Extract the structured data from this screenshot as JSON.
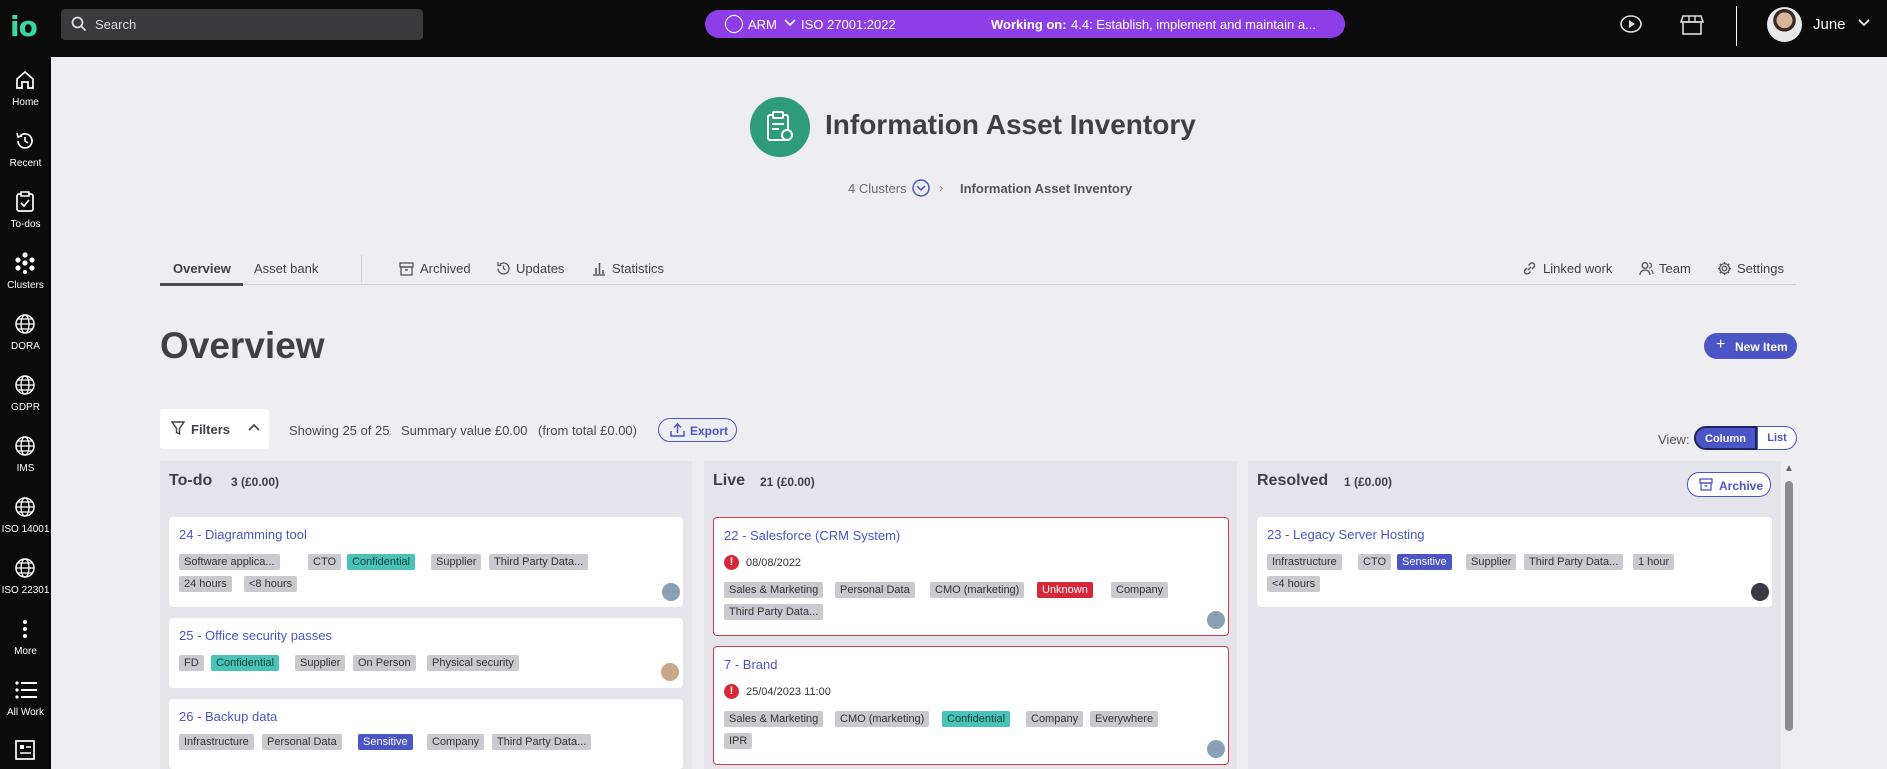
{
  "topbar": {
    "search_placeholder": "Search",
    "org": "ARM",
    "standard": "ISO 27001:2022",
    "working_on_label": "Working on:",
    "working_on_task": "4.4: Establish, implement and maintain a...",
    "user_name": "June",
    "accent": "#8e3ee6"
  },
  "sidebar": {
    "items": [
      {
        "label": "Home",
        "icon": "home-icon"
      },
      {
        "label": "Recent",
        "icon": "history-icon"
      },
      {
        "label": "To-dos",
        "icon": "clipboard-check-icon"
      },
      {
        "label": "Clusters",
        "icon": "clusters-icon"
      },
      {
        "label": "DORA",
        "icon": "globe-icon"
      },
      {
        "label": "GDPR",
        "icon": "globe-icon"
      },
      {
        "label": "IMS",
        "icon": "globe-icon"
      },
      {
        "label": "ISO 14001",
        "icon": "globe-icon"
      },
      {
        "label": "ISO 22301",
        "icon": "globe-icon"
      },
      {
        "label": "More",
        "icon": "more-vertical-icon"
      },
      {
        "label": "All Work",
        "icon": "list-icon"
      }
    ]
  },
  "header": {
    "title": "Information Asset Inventory",
    "breadcrumb": {
      "parent": "4 Clusters",
      "current": "Information Asset Inventory"
    }
  },
  "tabs": {
    "overview": "Overview",
    "asset_bank": "Asset bank",
    "archived": "Archived",
    "updates": "Updates",
    "statistics": "Statistics",
    "linked_work": "Linked work",
    "team": "Team",
    "settings": "Settings"
  },
  "overview": {
    "title": "Overview",
    "new_item": "New Item",
    "filters": "Filters",
    "showing": "Showing 25 of 25",
    "summary": "Summary value £0.00",
    "from_total": "(from total £0.00)",
    "export": "Export",
    "view_label": "View:",
    "view_column": "Column",
    "view_list": "List"
  },
  "columns": [
    {
      "name": "To-do",
      "count": "3 (£0.00)",
      "cards": [
        {
          "title": "24 - Diagramming tool",
          "tags": [
            "Software applica...",
            "CTO",
            "Confidential",
            "Supplier",
            "Third Party Data...",
            "24 hours",
            "<8 hours"
          ]
        },
        {
          "title": "25 - Office security passes",
          "tags": [
            "FD",
            "Confidential",
            "Supplier",
            "On Person",
            "Physical security"
          ]
        },
        {
          "title": "26 - Backup data",
          "tags": [
            "Infrastructure",
            "Personal Data",
            "Sensitive",
            "Company",
            "Third Party Data..."
          ]
        }
      ]
    },
    {
      "name": "Live",
      "count": "21 (£0.00)",
      "cards": [
        {
          "title": "22 - Salesforce (CRM System)",
          "date": "08/08/2022",
          "tags": [
            "Sales & Marketing",
            "Personal Data",
            "CMO (marketing)",
            "Unknown",
            "Company",
            "Third Party Data..."
          ]
        },
        {
          "title": "7 - Brand",
          "date": "25/04/2023 11:00",
          "tags": [
            "Sales & Marketing",
            "CMO (marketing)",
            "Confidential",
            "Company",
            "Everywhere",
            "IPR"
          ]
        }
      ]
    },
    {
      "name": "Resolved",
      "count": "1 (£0.00)",
      "archive": "Archive",
      "cards": [
        {
          "title": "23 - Legacy Server Hosting",
          "tags": [
            "Infrastructure",
            "CTO",
            "Sensitive",
            "Supplier",
            "Third Party Data...",
            "1 hour",
            "<4 hours"
          ]
        }
      ]
    }
  ]
}
